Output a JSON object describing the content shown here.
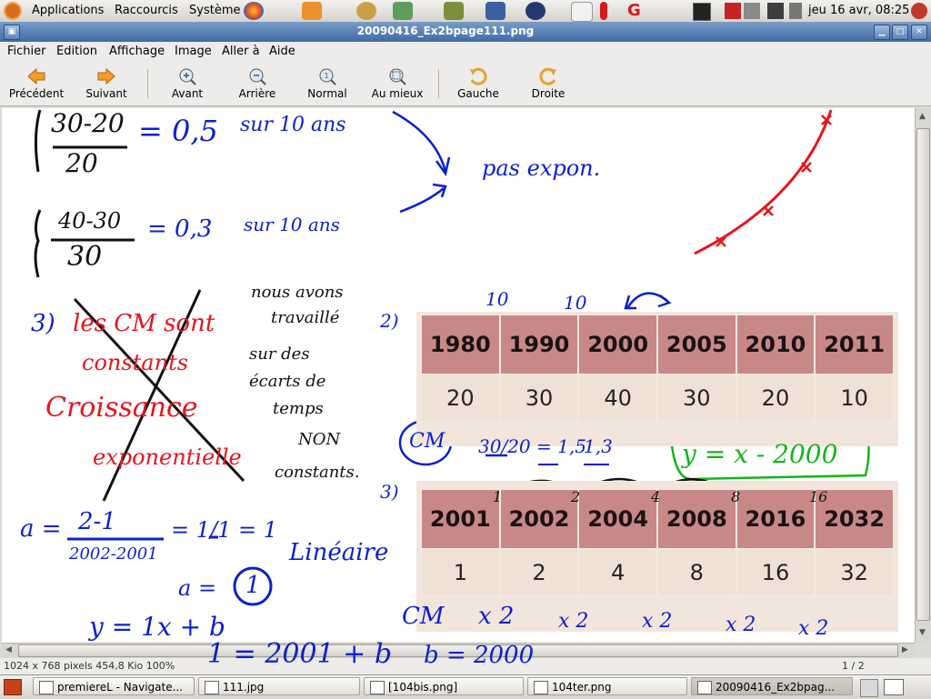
{
  "top_panel": {
    "menus": [
      "Applications",
      "Raccourcis",
      "Système"
    ],
    "clock": "jeu 16 avr, 08:25"
  },
  "window": {
    "title": "20090416_Ex2bpage111.png"
  },
  "menubar": [
    "Fichier",
    "Edition",
    "Affichage",
    "Image",
    "Aller à",
    "Aide"
  ],
  "toolbar": {
    "previous": "Précédent",
    "next": "Suivant",
    "zoom_in": "Avant",
    "zoom_out": "Arrière",
    "normal": "Normal",
    "best_fit": "Au mieux",
    "rotate_left": "Gauche",
    "rotate_right": "Droite"
  },
  "image": {
    "table1": {
      "years": [
        "1980",
        "1990",
        "2000",
        "2005",
        "2010",
        "2011"
      ],
      "values": [
        "20",
        "30",
        "40",
        "30",
        "20",
        "10"
      ]
    },
    "table2": {
      "years": [
        "2001",
        "2002",
        "2004",
        "2008",
        "2016",
        "2032"
      ],
      "values": [
        "1",
        "2",
        "4",
        "8",
        "16",
        "32"
      ]
    },
    "notes": {
      "frac1_num": "30-20",
      "frac1_den": "20",
      "frac1_result": "= 0,5",
      "frac1_text": "sur 10 ans",
      "frac2_num": "40-30",
      "frac2_den": "30",
      "frac2_result": "= 0,3",
      "frac2_text": "sur 10 ans",
      "pas_expon": "pas expon.",
      "q3": "3)",
      "cm_constants": "les CM sont",
      "constants": "constants",
      "croissance": "Croissance",
      "exponentielle": "exponentielle",
      "nous_avons_1": "nous avons",
      "nous_avons_2": "travaillé",
      "nous_avons_3": "sur des",
      "nous_avons_4": "écarts de",
      "nous_avons_5": "temps",
      "non": "NON",
      "constants2": "constants.",
      "q2": "2)",
      "q3b": "3)",
      "ten_a": "10",
      "ten_b": "10",
      "cm": "CM",
      "cm_ratio": "30/20 = 1,5",
      "cm_ratio2": "1,3",
      "equation": "y = x - 2000",
      "a_eq": "a =",
      "a_num": "2-1",
      "a_den": "2002-2001",
      "a_frac": "= 1/1 = 1",
      "lineaire": "Linéaire",
      "a_is": "a =",
      "a_val": "1",
      "y_eq": "y = 1x + b",
      "one_eq": "1 = 2001 + b",
      "b_eq": "b = 2000",
      "cm2": "CM",
      "times2": "x 2",
      "n1": "1",
      "n2": "2",
      "n4": "4",
      "n8": "8",
      "n16": "16",
      "q3c": "3)"
    }
  },
  "statusbar": {
    "info": "1024 x 768 pixels  454,8 Kio    100%",
    "page": "1 / 2"
  },
  "taskbar": [
    "premiereL - Navigate...",
    "111.jpg",
    "[104bis.png]",
    "104ter.png",
    "20090416_Ex2bpag..."
  ]
}
